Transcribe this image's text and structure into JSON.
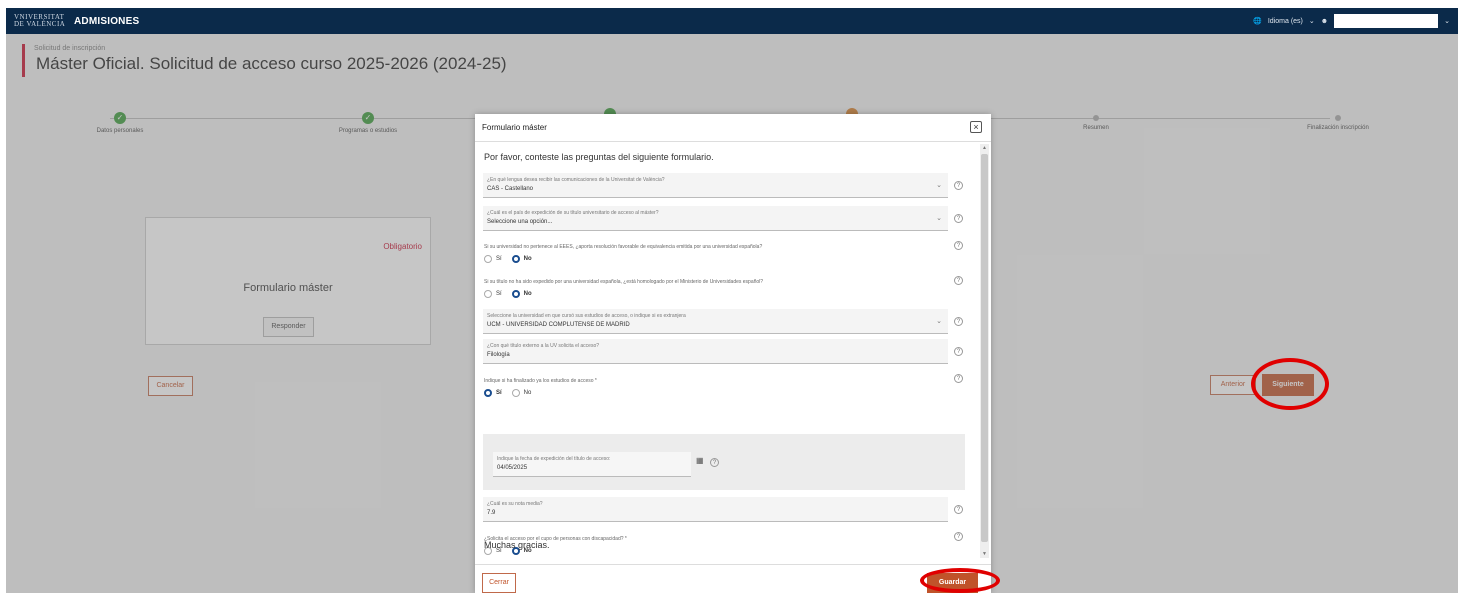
{
  "topbar": {
    "logo_line1": "VNIVERSITAT",
    "logo_line2": "DE VALÈNCIA",
    "app_name": "ADMISIONES",
    "language": "Idioma (es)"
  },
  "page": {
    "breadcrumb": "Solicitud de inscripción",
    "title": "Máster Oficial. Solicitud de acceso curso 2025-2026 (2024-25)"
  },
  "steps": [
    {
      "label": "Datos personales",
      "state": "done"
    },
    {
      "label": "Programas o estudios",
      "state": "done"
    },
    {
      "label": "Resumen",
      "state": "todo"
    },
    {
      "label": "Finalización inscripción",
      "state": "todo"
    }
  ],
  "card": {
    "required": "Obligatorio",
    "title": "Formulario máster",
    "respond": "Responder"
  },
  "buttons": {
    "cancel": "Cancelar",
    "previous": "Anterior",
    "next": "Siguiente"
  },
  "modal": {
    "title": "Formulario máster",
    "intro": "Por favor, conteste las preguntas del siguiente formulario.",
    "fields": {
      "language_label": "¿En qué lengua desea recibir las comunicaciones de la Universitat de València?",
      "language_value": "CAS - Castellano",
      "country_label": "¿Cuál es el país de expedición de su título universitario de acceso al máster?",
      "country_value": "Seleccione una opción...",
      "q_agency": "Si su universidad no pertenece al EEES, ¿aporta resolución favorable de equivalencia emitida por una universidad española?",
      "q_homolog": "Si su título no ha sido expedido por una universidad española, ¿está homologado por el Ministerio de Universidades español?",
      "university_label": "Seleccione la universidad en que cursó sus estudios de acceso, o indique si es extranjera",
      "university_value": "UCM - UNIVERSIDAD COMPLUTENSE DE MADRID",
      "degree_label": "¿Con qué título externo a la UV solicita el acceso?",
      "degree_value": "Filología",
      "q_finished": "Indique si ha finalizado ya los estudios de acceso *",
      "date_label": "Indique la fecha de expedición del título de acceso:",
      "date_value": "04/05/2025",
      "grade_label": "¿Cuál es su nota media?",
      "grade_value": "7.9",
      "q_disability": "¿Solicita el acceso por el cupo de personas con discapacidad? *"
    },
    "yes": "Sí",
    "no": "No",
    "thanks": "Muchas gracias.",
    "close": "Cerrar",
    "save": "Guardar"
  },
  "colors": {
    "topbar": "#0b2a4a",
    "accent": "#c0532a",
    "annotation": "#e00000"
  }
}
